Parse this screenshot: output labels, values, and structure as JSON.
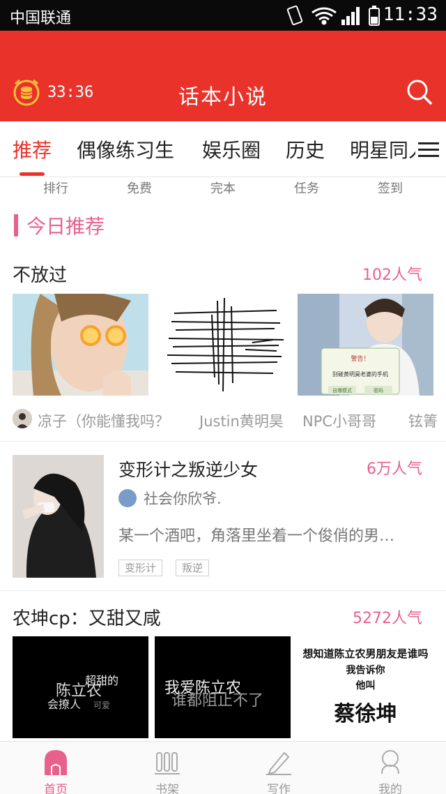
{
  "status_bar": {
    "carrier": "中国联通",
    "time": "11:33",
    "icons": [
      "vibrate-icon",
      "wifi-icon",
      "signal-icon",
      "battery-icon"
    ]
  },
  "app_bar": {
    "coin_count": "33:36",
    "title": "话本小说",
    "accent": "#e8322a"
  },
  "tabs": [
    {
      "label": "推荐",
      "active": true
    },
    {
      "label": "偶像练习生",
      "active": false
    },
    {
      "label": "娱乐圈",
      "active": false
    },
    {
      "label": "历史",
      "active": false
    },
    {
      "label": "明星同人",
      "active": false
    }
  ],
  "subnav": [
    "排行",
    "免费",
    "完本",
    "任务",
    "签到"
  ],
  "section": {
    "title": "今日推荐",
    "color": "#e8608c"
  },
  "block1": {
    "name": "不放过",
    "popularity": "102人气",
    "authors": [
      "凉子（你能懂我吗？",
      "Justin黄明昊",
      "NPC小哥哥",
      "铉箐"
    ],
    "thumb3_caption": [
      "警告！",
      "别碰黄明昊老婆的手机",
      "自爆模式",
      "密码"
    ]
  },
  "story": {
    "title": "变形计之叛逆少女",
    "popularity": "6万人气",
    "author": "社会你欣爷.",
    "description": "某一个酒吧，角落里坐着一个俊俏的男…",
    "tags": [
      "变形计",
      "叛逆"
    ]
  },
  "block2": {
    "name": "农坤cp：又甜又咸",
    "popularity": "5272人气",
    "card1": [
      "陈立农",
      "超甜的",
      "会撩人",
      "可爱"
    ],
    "card2": [
      "我爱陈立农",
      "谁都阻止不了"
    ],
    "card3": [
      "想知道陈立农男朋友是谁吗",
      "我告诉你",
      "他叫",
      "蔡徐坤"
    ]
  },
  "bottom_nav": [
    {
      "label": "首页",
      "icon": "home-icon",
      "active": true
    },
    {
      "label": "书架",
      "icon": "bookshelf-icon",
      "active": false
    },
    {
      "label": "写作",
      "icon": "pencil-icon",
      "active": false
    },
    {
      "label": "我的",
      "icon": "profile-icon",
      "active": false
    }
  ]
}
